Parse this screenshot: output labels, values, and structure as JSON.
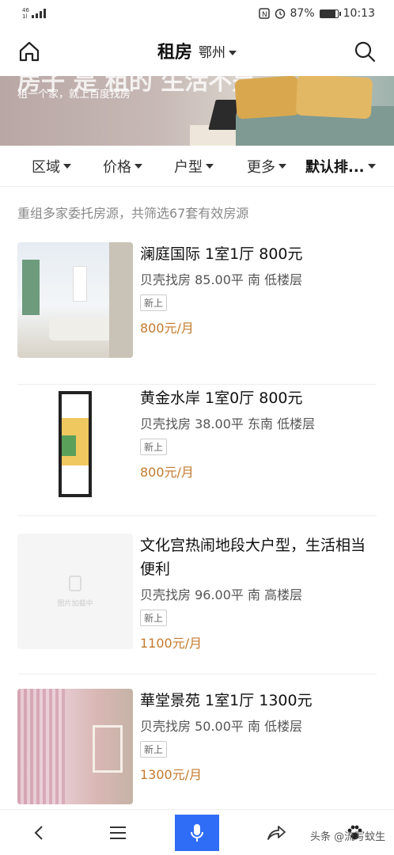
{
  "status_bar": {
    "network": "4G",
    "network_sub": "46",
    "signal_sub": "1l",
    "battery_pct_text": "87%",
    "battery_level": 0.87,
    "time": "10:13"
  },
  "nav": {
    "home_icon": "home-icon",
    "title": "租房",
    "city": "鄂州",
    "search_icon": "search-icon"
  },
  "banner": {
    "headline": "房子 是 租的 生活不是",
    "subtitle": "租一个家，就上百度找房"
  },
  "filters": [
    {
      "label": "区域"
    },
    {
      "label": "价格"
    },
    {
      "label": "户型"
    },
    {
      "label": "更多"
    },
    {
      "label": "默认排..."
    }
  ],
  "results": {
    "summary": "重组多家委托房源，共筛选67套有效房源"
  },
  "listings": [
    {
      "title": "澜庭国际 1室1厅 800元",
      "meta": "贝壳找房  85.00平  南  低楼层",
      "tag": "新上",
      "price": "800元/月"
    },
    {
      "title": "黄金水岸 1室0厅 800元",
      "meta": "贝壳找房  38.00平  东南  低楼层",
      "tag": "新上",
      "price": "800元/月"
    },
    {
      "title": "文化宫热闹地段大户型，生活相当便利",
      "meta": "贝壳找房  96.00平  南  高楼层",
      "tag": "新上",
      "price": "1100元/月",
      "thumb_text": "图片加载中"
    },
    {
      "title": "華堂景苑 1室1厅 1300元",
      "meta": "贝壳找房  50.00平  南  低楼层",
      "tag": "新上",
      "price": "1300元/月"
    }
  ],
  "bottom_nav": {
    "back_icon": "back-icon",
    "menu_icon": "menu-icon",
    "mic_icon": "mic-icon",
    "share_icon": "share-icon",
    "paw_icon": "paw-icon",
    "accent": "#2f6df6"
  },
  "watermark": "头条 @流写蚊生"
}
